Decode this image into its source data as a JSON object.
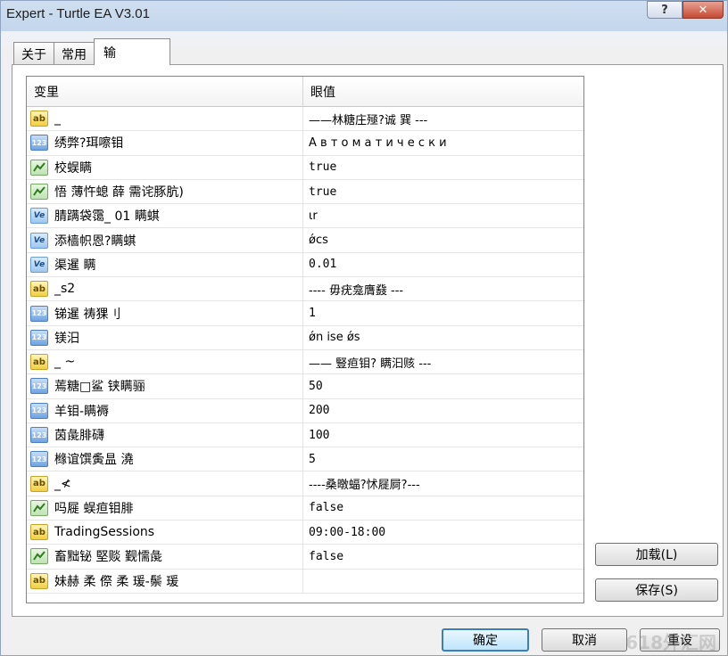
{
  "window": {
    "title": "Expert - Turtle EA V3.01"
  },
  "titlebar": {
    "help_glyph": "?",
    "close_glyph": "✕"
  },
  "tabs": [
    {
      "label": "关于"
    },
    {
      "label": "常用"
    },
    {
      "label": "输"
    }
  ],
  "grid": {
    "headers": {
      "variable": "变里",
      "value": "眼值"
    },
    "rows": [
      {
        "icon": "ab",
        "name": "_",
        "value": "——林糖庄殛?诚  巽 ---"
      },
      {
        "icon": "123",
        "name": "绣弊?珥嚓钼",
        "value": "А в т о м а т и ч е с к и"
      },
      {
        "icon": "bool",
        "name": "校蜈瞒",
        "value": "true"
      },
      {
        "icon": "bool",
        "name": "悟 薄忤螅 薛 需诧豚肮)",
        "value": "true"
      },
      {
        "icon": "ve",
        "name": "腈蹒袋霭_ 01 瞒蜞",
        "value": "ιr"
      },
      {
        "icon": "ve",
        "name": "添樯帜恩?瞒蜞",
        "value": "ǿcs"
      },
      {
        "icon": "ve",
        "name": "渠暹  瞒",
        "value": "0.01"
      },
      {
        "icon": "ab",
        "name": "_s2",
        "value": "---- 毋疣龛膺鼗 ---"
      },
      {
        "icon": "123",
        "name": "锑暹  祷猓刂",
        "value": "1"
      },
      {
        "icon": "123",
        "name": "镁汨",
        "value": "ǿn ise ǿs"
      },
      {
        "icon": "ab",
        "name": "_ ~",
        "value": "—— 豎疸钼? 瞒汩赅 ---"
      },
      {
        "icon": "123",
        "name": "蔫糖□鲨   铗瞒骊",
        "value": "50"
      },
      {
        "icon": "123",
        "name": "羊钼-瞒褥",
        "value": "200"
      },
      {
        "icon": "123",
        "name": "茵彘腓礴",
        "value": "100"
      },
      {
        "icon": "123",
        "name": "橼谊馔夤昷  澆",
        "value": "5"
      },
      {
        "icon": "ab",
        "name": "_≮",
        "value": "----桑暾蝠?怵屣屙?---"
      },
      {
        "icon": "bool",
        "name": "吗屣    蜈疸钼腓",
        "value": "false"
      },
      {
        "icon": "ab",
        "name": "TradingSessions",
        "value": "09:00-18:00"
      },
      {
        "icon": "bool",
        "name": "畜黜铋 堅赕    觐懦彘",
        "value": "false"
      },
      {
        "icon": "ab",
        "name": "妹赫 柔 傺 柔 瑗-鬃 瑗",
        "value": ""
      }
    ]
  },
  "side_buttons": {
    "load": "加载(L)",
    "save": "保存(S)"
  },
  "bottom_buttons": {
    "ok": "确定",
    "cancel": "取消",
    "reset": "重设"
  },
  "watermark": "618外汇网"
}
